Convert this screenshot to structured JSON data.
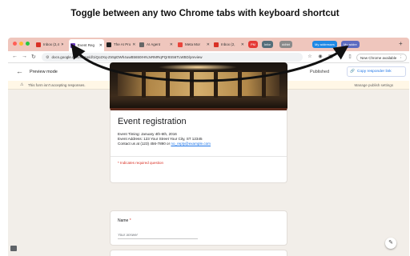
{
  "headline": "Toggle between any two Chrome tabs with keyboard shortcut",
  "window_controls": {
    "close_color": "#ff5f57",
    "minimize_color": "#febc2e",
    "zoom_color": "#28c840"
  },
  "tabs": [
    {
      "label": "Inbox (2,4",
      "favicon": "mail-icon",
      "favicon_color": "#d93025"
    },
    {
      "label": "Event Reg",
      "favicon": "forms-icon",
      "favicon_color": "#673ab7",
      "active": true
    },
    {
      "label": "The AI Pro",
      "favicon": "page-icon",
      "favicon_color": "#222222"
    },
    {
      "label": "AI Agent",
      "favicon": "page-icon",
      "favicon_color": "#666666"
    },
    {
      "label": "Meta Mor",
      "favicon": "page-icon",
      "favicon_color": "#e8453c"
    },
    {
      "label": "Inbox (2,",
      "favicon": "mail-icon",
      "favicon_color": "#d93025"
    }
  ],
  "tab_chips": [
    {
      "label": "PM",
      "color": "#e53935"
    },
    {
      "label": "Infor",
      "color": "#546e7a"
    },
    {
      "label": "ddhbt",
      "color": "#8a8a8a"
    },
    {
      "label": "My addresses",
      "color": "#1e88e5"
    },
    {
      "label": "My addre",
      "color": "#5c6bc0"
    }
  ],
  "address_bar": {
    "url": "docs.google.com/forms/d/1iQo2Xq-Zn5pDWh4uwB5650rHNJvRMRqPQr8S56TLWBD/preview"
  },
  "toolbar": {
    "new_chrome_label": "New Chrome available"
  },
  "forms_header": {
    "title": "Preview mode",
    "status": "Published",
    "copy_link_label": "Copy responder link"
  },
  "notice": {
    "text": "This form isn't accepting responses.",
    "manage_label": "Manage publish settings"
  },
  "form": {
    "title": "Event registration",
    "description_lines": [
      "Event Timing: January 4th-6th, 2016",
      "Event Address: 123 Your Street Your City, ST 12345",
      "Contact us at (123) 456-7890 or "
    ],
    "contact_email": "no_reply@example.com",
    "required_note": "* Indicates required question",
    "accent_color": "#5a2a1c"
  },
  "question": {
    "label": "Name",
    "required_mark": "*",
    "placeholder": "Your answer"
  }
}
